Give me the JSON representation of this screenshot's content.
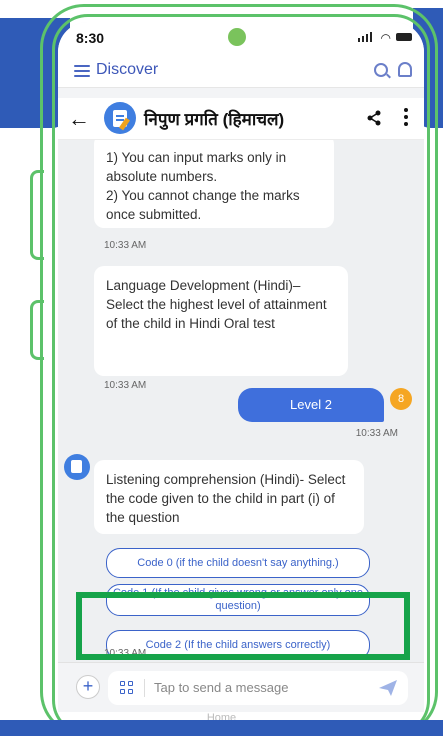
{
  "status_bar": {
    "time": "8:30"
  },
  "top_bar": {
    "title": "Discover"
  },
  "chat_header": {
    "title": "निपुण प्रगति (हिमाचल)"
  },
  "messages": {
    "bot1": {
      "line1": "1) You can input marks only in absolute numbers.",
      "line2": "2) You cannot change the marks once submitted.",
      "time": "10:33 AM"
    },
    "bot2": {
      "text": "Language Development (Hindi)– Select the highest level of attainment of the child in Hindi Oral test",
      "time": "10:33 AM"
    },
    "user1": {
      "text": "Level 2",
      "time": "10:33 AM",
      "avatar_letter": "8"
    },
    "bot3": {
      "text": "Listening comprehension (Hindi)- Select the code given to the child in part (i) of the question",
      "time": "10:33 AM"
    }
  },
  "options": [
    {
      "label": "Code 0 (if the child doesn't say anything.)"
    },
    {
      "label": "Code 1 (If the child gives wrong or answer only one question)"
    },
    {
      "label": "Code 2 (If the child answers correctly)"
    }
  ],
  "input": {
    "placeholder": "Tap to send a message"
  },
  "footer": {
    "text": "Home"
  },
  "colors": {
    "primary": "#3b63c9",
    "highlight": "#16a34a",
    "frame": "#5cc26a",
    "user_avatar": "#f5a623"
  },
  "icons": [
    "menu-icon",
    "search-icon",
    "bell-icon",
    "back-arrow-icon",
    "share-icon",
    "more-vert-icon",
    "plus-icon",
    "grid-icon",
    "send-icon"
  ]
}
